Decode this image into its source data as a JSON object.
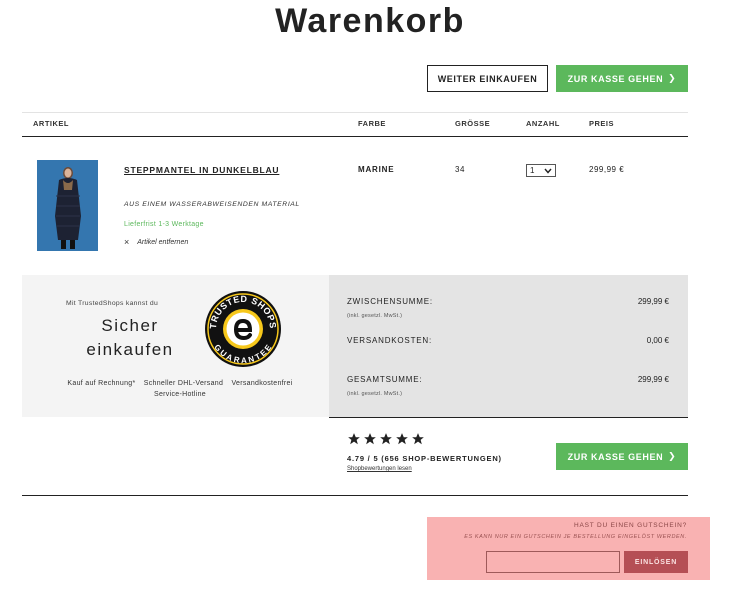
{
  "page": {
    "title": "Warenkorb"
  },
  "actions": {
    "continue_label": "WEITER EINKAUFEN",
    "checkout_label": "ZUR KASSE GEHEN",
    "chevron": "❯"
  },
  "table": {
    "headers": {
      "article": "ARTIKEL",
      "color": "FARBE",
      "size": "GRÖSSE",
      "quantity": "ANZAHL",
      "price": "PREIS"
    }
  },
  "item": {
    "name": "STEPPMANTEL IN DUNKELBLAU",
    "color": "MARINE",
    "size": "34",
    "quantity": "1",
    "price": "299,99 €",
    "description": "AUS EINEM WASSERABWEISENDEN MATERIAL",
    "delivery": "Lieferfrist 1-3 Werktage",
    "remove_label": "Artikel entfernen",
    "remove_icon": "×",
    "image_icon": "dark-navy-quilted-coat"
  },
  "trust": {
    "intro": "Mit TrustedShops kannst du",
    "headline_1": "Sicher",
    "headline_2": "einkaufen",
    "features": [
      "Kauf auf Rechnung*",
      "Schneller DHL-Versand",
      "Versandkostenfrei",
      "Service-Hotline"
    ],
    "badge_top": "TRUSTED SHOPS",
    "badge_bottom": "GUARANTEE",
    "badge_letter": "e"
  },
  "summary": {
    "subtotal_label": "ZWISCHENSUMME:",
    "subtotal_note": "(inkl. gesetzl. MwSt.)",
    "subtotal_value": "299,99 €",
    "shipping_label": "VERSANDKOSTEN:",
    "shipping_value": "0,00 €",
    "total_label": "GESAMTSUMME:",
    "total_note": "(inkl. gesetzl. MwSt.)",
    "total_value": "299,99 €"
  },
  "rating": {
    "stars": 5,
    "text": "4.79 / 5 (656 SHOP-BEWERTUNGEN)",
    "link": "Shopbewertungen lesen"
  },
  "coupon": {
    "title": "HAST DU EINEN GUTSCHEIN?",
    "note": "ES KANN NUR EIN GUTSCHEIN JE BESTELLUNG EINGELÖST WERDEN.",
    "input_value": "",
    "button_label": "EINLÖSEN"
  },
  "colors": {
    "accent_green": "#5cb85c",
    "coupon_bg": "#f9b2b2",
    "coupon_button": "#b54f55"
  }
}
